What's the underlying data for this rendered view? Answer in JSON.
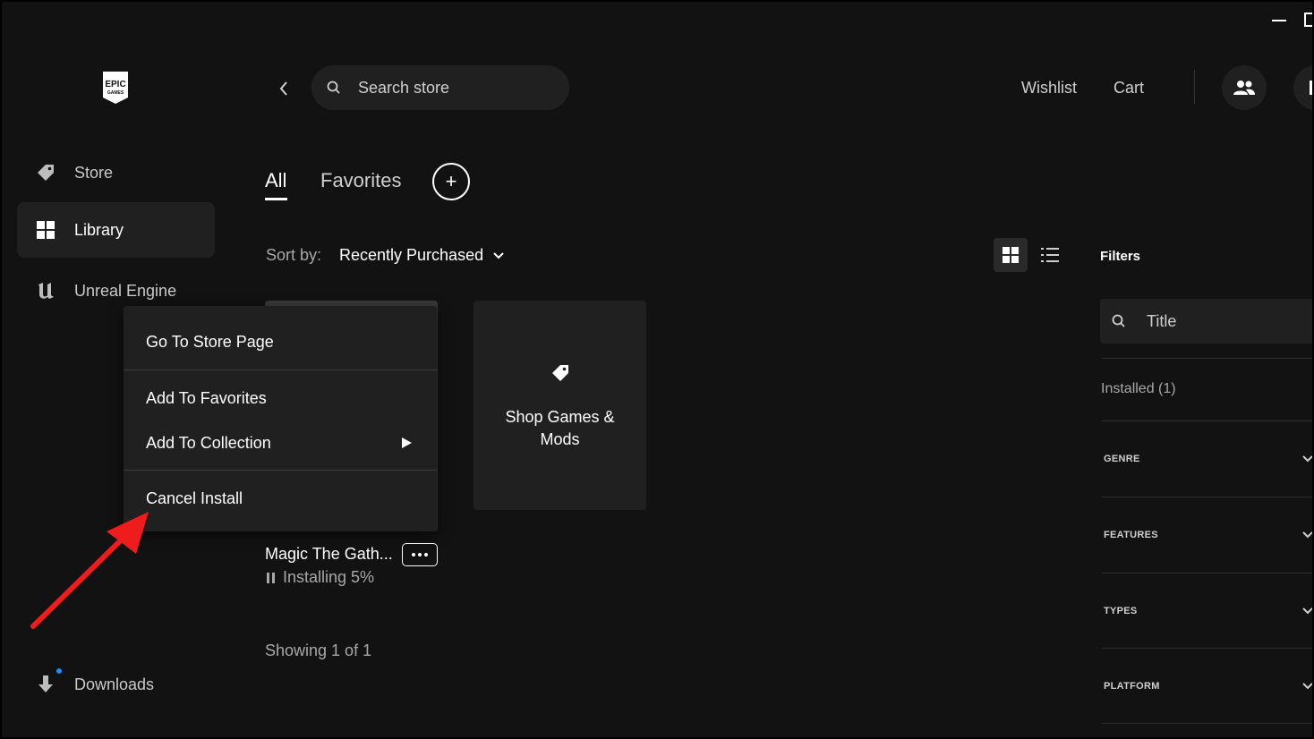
{
  "sidebar": {
    "logo_text": "EPIC GAMES",
    "items": [
      {
        "label": "Store",
        "icon": "tag-icon"
      },
      {
        "label": "Library",
        "icon": "grid-icon",
        "active": true
      },
      {
        "label": "Unreal Engine",
        "icon": "unreal-icon"
      }
    ],
    "downloads": {
      "label": "Downloads",
      "icon": "download-icon",
      "has_badge": true
    }
  },
  "header": {
    "search_placeholder": "Search store",
    "wishlist": "Wishlist",
    "cart": "Cart"
  },
  "library": {
    "tabs": [
      {
        "label": "All",
        "active": true
      },
      {
        "label": "Favorites",
        "active": false
      }
    ],
    "add_collection": "+",
    "sort_label": "Sort by:",
    "sort_value": "Recently Purchased",
    "view_mode": "grid",
    "games": [
      {
        "title": "Magic The Gath...",
        "status": "Installing 5%",
        "progress": 0.05
      }
    ],
    "shop_card": {
      "line1": "Shop Games &",
      "line2": "Mods"
    },
    "showing": "Showing 1 of 1"
  },
  "context_menu": {
    "items": [
      "Go To Store Page",
      "Add To Favorites",
      "Add To Collection",
      "Cancel Install"
    ]
  },
  "filters": {
    "title": "Filters",
    "search_placeholder": "Title",
    "installed": "Installed (1)",
    "sections": [
      "GENRE",
      "FEATURES",
      "TYPES",
      "PLATFORM"
    ]
  },
  "colors": {
    "background": "#121212",
    "surface": "#202020",
    "annotation_arrow": "#ee1c1c",
    "notification_dot": "#1a8cff"
  }
}
